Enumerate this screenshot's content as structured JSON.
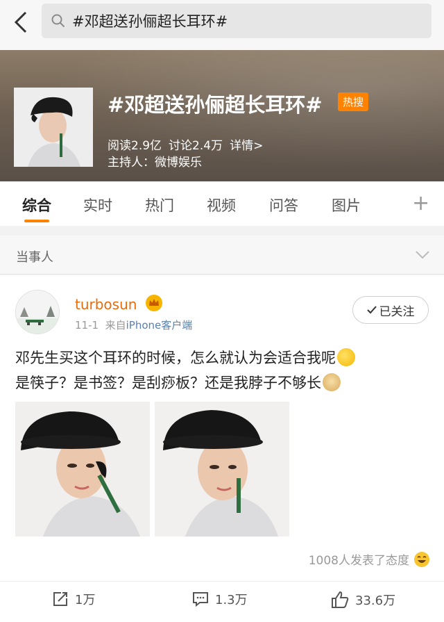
{
  "search": {
    "value": "#邓超送孙俪超长耳环#"
  },
  "topic": {
    "title": "#邓超送孙俪超长耳环#",
    "badge": "热搜",
    "reads": "阅读2.9亿",
    "discussions": "讨论2.4万",
    "details": "详情>",
    "host": "主持人：微博娱乐"
  },
  "tabs": [
    "综合",
    "实时",
    "热门",
    "视频",
    "问答",
    "图片"
  ],
  "section": {
    "label": "当事人"
  },
  "post": {
    "username": "turbosun",
    "time": "11-1",
    "source_prefix": "来自",
    "source": "iPhone客户端",
    "follow_label": "已关注",
    "text_line1": "邓先生买这个耳环的时候，怎么就认为会适合我呢",
    "text_line2": "是筷子？是书签？是刮痧板？还是我脖子不够长",
    "reaction_text": "1008人发表了态度",
    "repost_count": "1万",
    "comment_count": "1.3万",
    "like_count": "33.6万"
  },
  "colors": {
    "accent": "#ff8200",
    "username": "#e86b0a",
    "link": "#5b7fb0"
  }
}
